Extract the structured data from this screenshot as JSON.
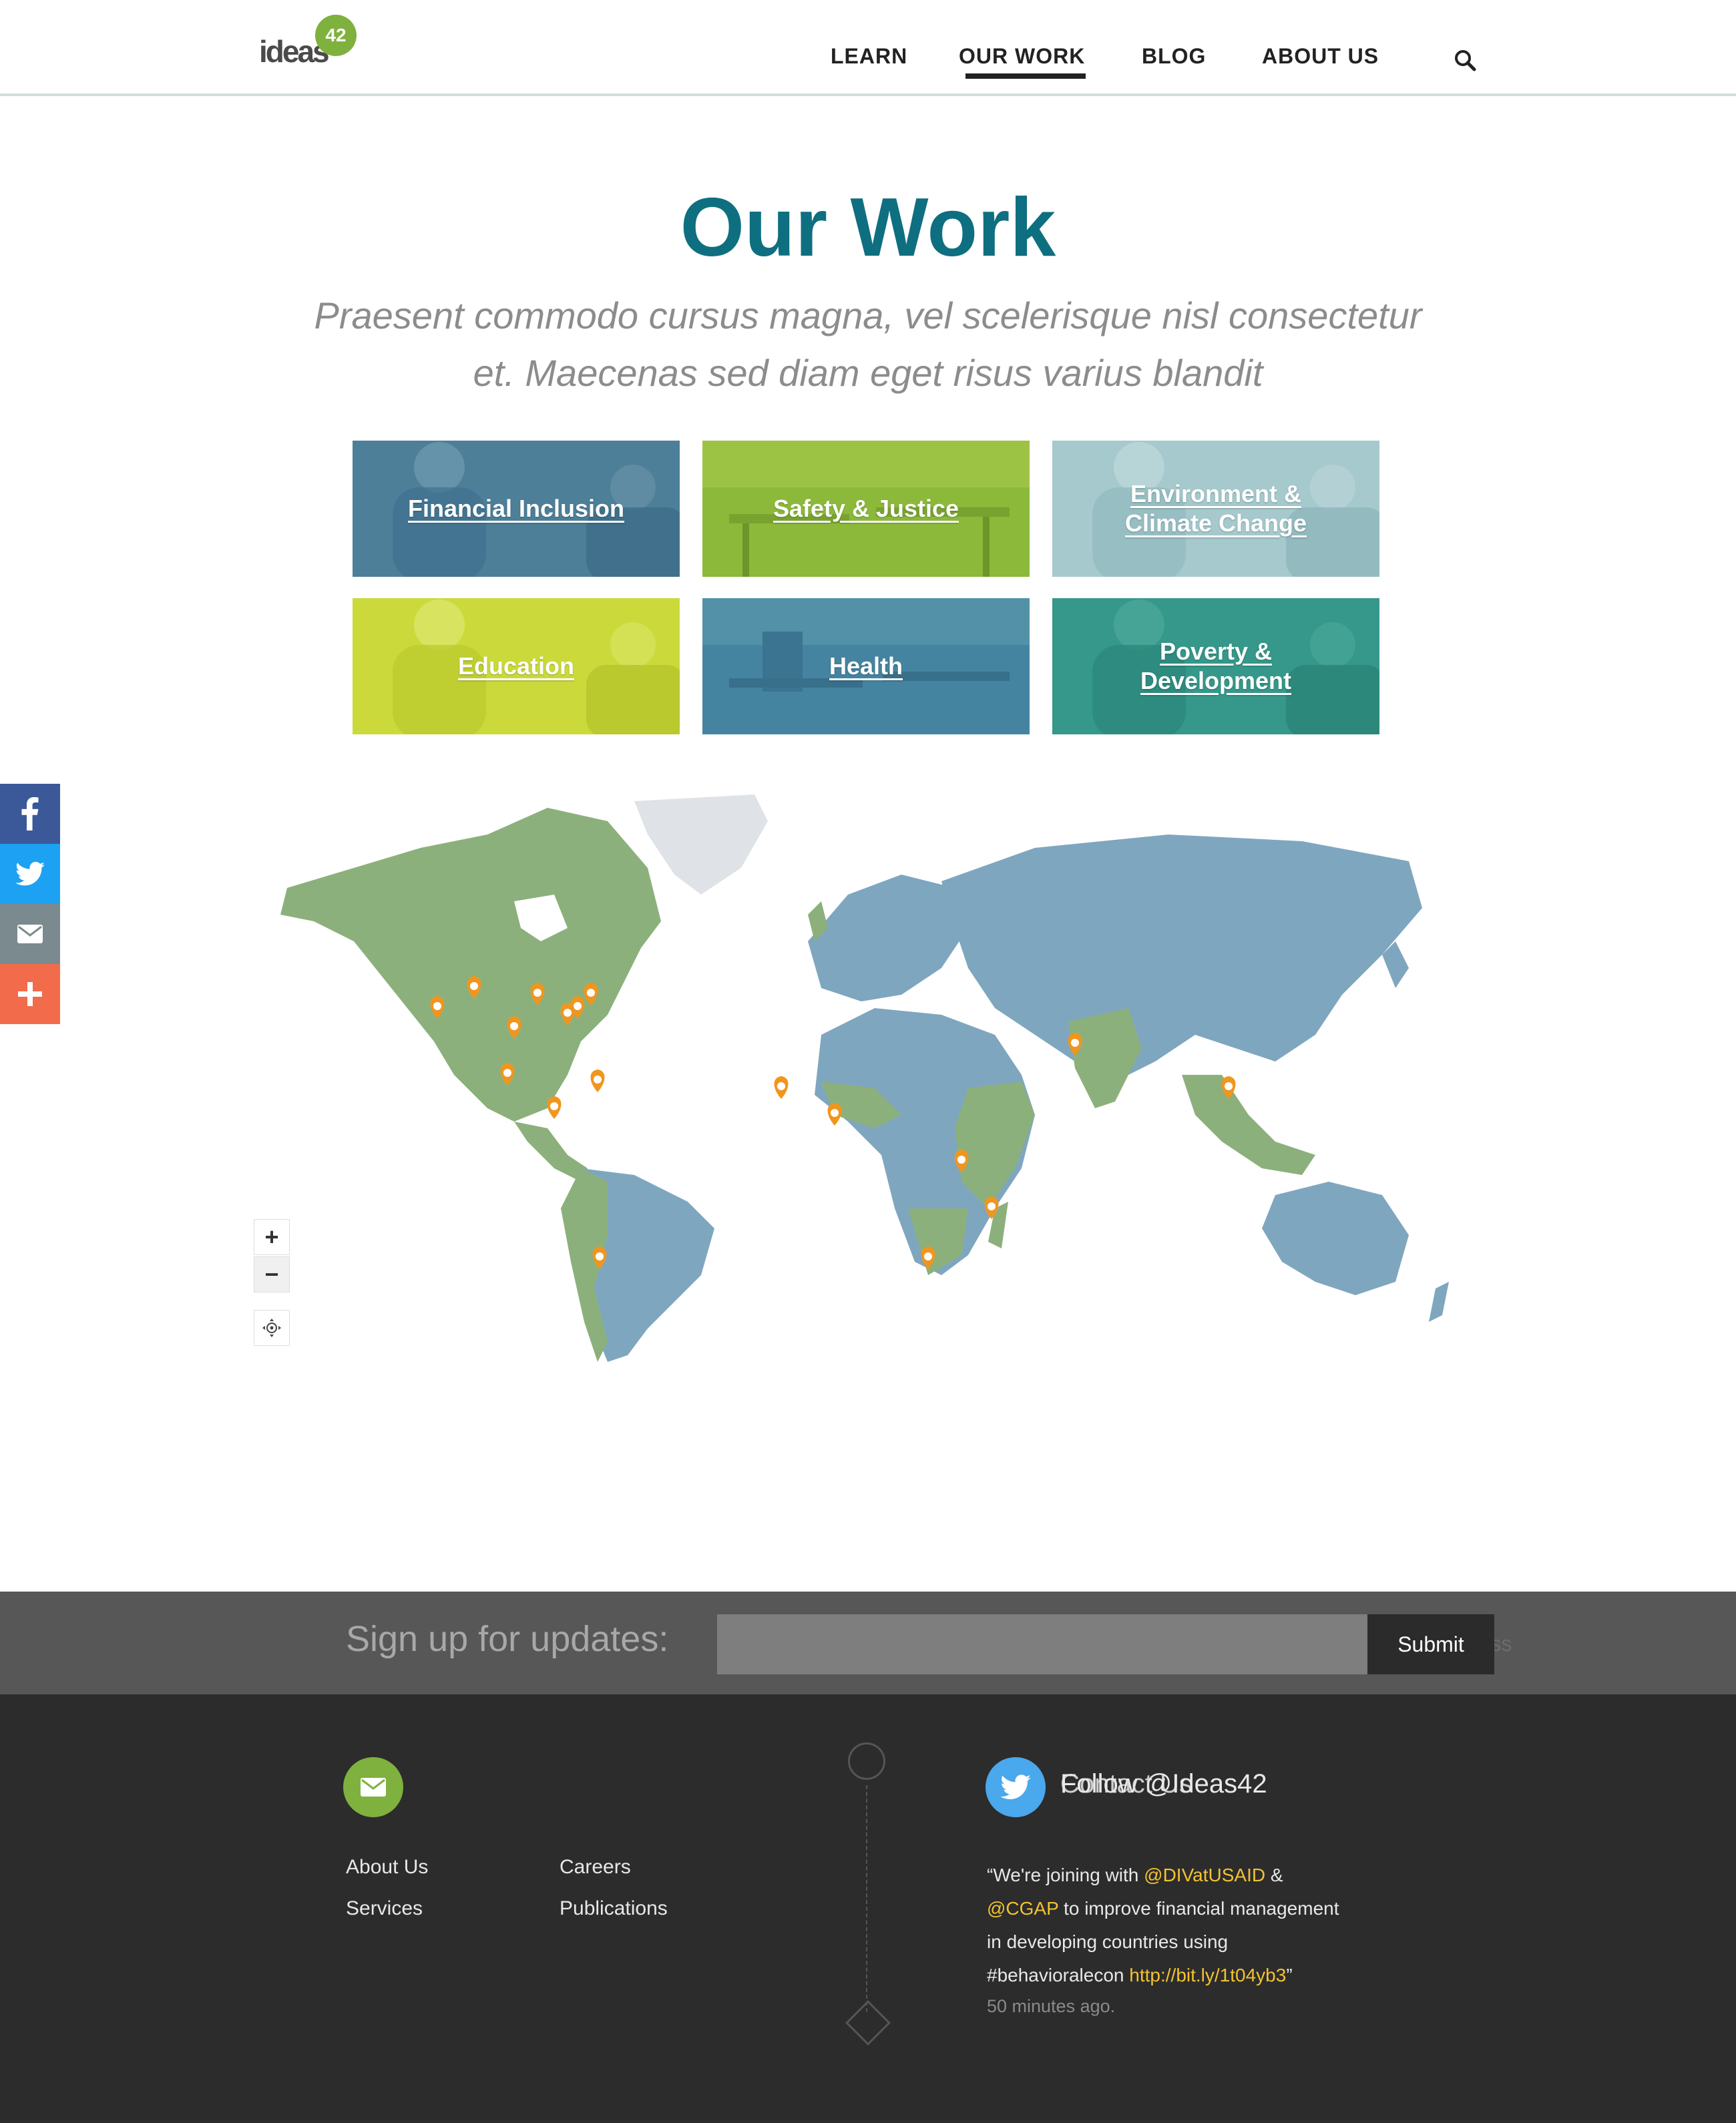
{
  "header": {
    "logo_text": "ideas",
    "logo_badge": "42",
    "nav": [
      {
        "label": "LEARN"
      },
      {
        "label": "OUR WORK"
      },
      {
        "label": "BLOG"
      },
      {
        "label": "ABOUT US"
      }
    ],
    "active_nav": "OUR WORK",
    "search_icon": "search-icon"
  },
  "hero": {
    "title": "Our Work",
    "subtitle_line1": "Praesent commodo cursus magna, vel scelerisque nisl consectetur",
    "subtitle_line2": "et. Maecenas sed diam eget risus varius blandit"
  },
  "categories": [
    {
      "label_line1": "Financial Inclusion",
      "label_line2": "",
      "overlay": "#2e6b8a"
    },
    {
      "label_line1": "Safety & Justice",
      "label_line2": "",
      "overlay": "#8cb93a"
    },
    {
      "label_line1": "Environment &",
      "label_line2": "Climate Change",
      "overlay": "#9cc4c8"
    },
    {
      "label_line1": "Education",
      "label_line2": "",
      "overlay": "#c9d836"
    },
    {
      "label_line1": "Health",
      "label_line2": "",
      "overlay": "#3e7f9c"
    },
    {
      "label_line1": "Poverty &",
      "label_line2": "Development",
      "overlay": "#2e9a86"
    }
  ],
  "share_bar": [
    {
      "icon": "facebook-icon",
      "color": "#3b5998"
    },
    {
      "icon": "twitter-icon",
      "color": "#1da1f2"
    },
    {
      "icon": "email-icon",
      "color": "#7b8a8e"
    },
    {
      "icon": "plus-icon",
      "color": "#f26b4a"
    }
  ],
  "map": {
    "zoom_in": "+",
    "zoom_out": "−",
    "reset_icon": "locate-icon",
    "marker_color": "#f0961e",
    "land_green": "#8db07a",
    "land_blue": "#7ea6c0"
  },
  "signup": {
    "label": "Sign up for updates:",
    "placeholder": "",
    "ghost_text": "ress",
    "submit": "Submit"
  },
  "footer": {
    "contact_icon": "envelope-icon",
    "links": [
      {
        "label": "About Us"
      },
      {
        "label": "Careers"
      },
      {
        "label": "Services"
      },
      {
        "label": "Publications"
      }
    ],
    "twitter_icon": "twitter-icon",
    "twitter_handle": "Follow @Ideas42",
    "twitter_handle_overlap": "Contact Us",
    "tweet": {
      "open_quote": "“We're joining with ",
      "mention1": "@DIVatUSAID",
      "amp": " &",
      "mention2": "@CGAP",
      "text1": " to improve financial management",
      "text2": "in developing countries using",
      "text3": "#behavioralecon ",
      "link": "http://bit.ly/1t04yb3",
      "close_quote": "”"
    },
    "tweet_time": "50 minutes ago."
  }
}
